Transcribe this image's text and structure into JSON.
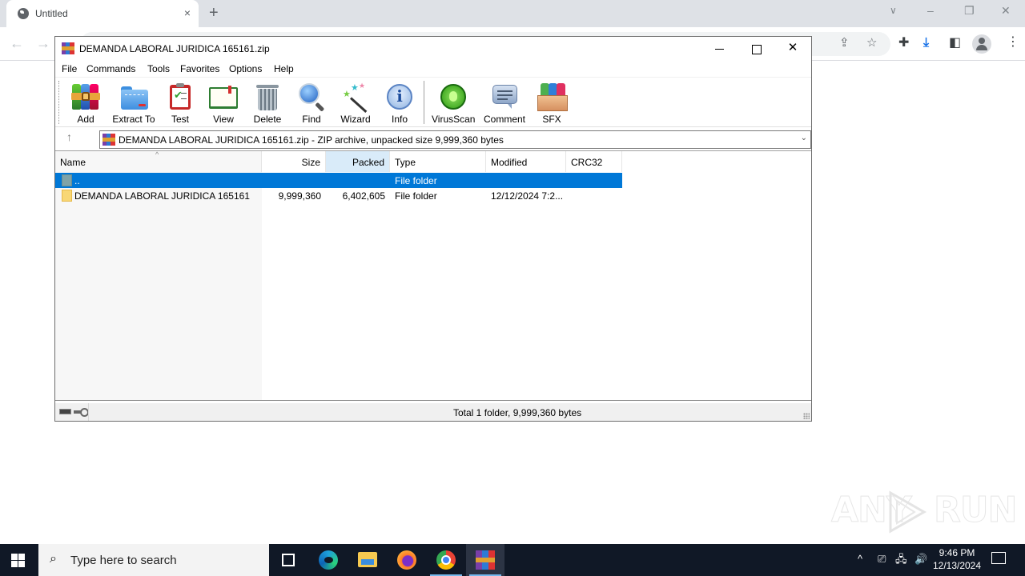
{
  "browser": {
    "tab_title": "Untitled",
    "tab_close": "×",
    "new_tab": "+",
    "tab_search_icon": "chevron-down",
    "window_controls": {
      "minimize": "–",
      "restore": "❐",
      "close": "✕"
    },
    "nav": {
      "back": "←",
      "forward": "→"
    },
    "toolbar_icons": [
      "share-icon",
      "star-icon",
      "extensions-icon",
      "download-icon",
      "side-panel-icon",
      "profile-icon",
      "menu-icon"
    ],
    "toolbar_glyphs": {
      "share": "⇪",
      "star": "☆",
      "extensions": "✚",
      "download": "⤓",
      "side_panel": "◧",
      "menu": "⋮"
    }
  },
  "winrar": {
    "title": "DEMANDA LABORAL JURIDICA 165161.zip",
    "window_controls": {
      "close": "✕"
    },
    "menu": [
      "File",
      "Commands",
      "Tools",
      "Favorites",
      "Options",
      "Help"
    ],
    "toolbar": [
      {
        "id": "add",
        "label": "Add"
      },
      {
        "id": "extract",
        "label": "Extract To"
      },
      {
        "id": "test",
        "label": "Test"
      },
      {
        "id": "view",
        "label": "View"
      },
      {
        "id": "delete",
        "label": "Delete"
      },
      {
        "id": "find",
        "label": "Find"
      },
      {
        "id": "wizard",
        "label": "Wizard"
      },
      {
        "id": "info",
        "label": "Info"
      },
      {
        "id": "virusscan",
        "label": "VirusScan"
      },
      {
        "id": "comment",
        "label": "Comment"
      },
      {
        "id": "sfx",
        "label": "SFX"
      }
    ],
    "address": {
      "up_glyph": "↑",
      "path": "DEMANDA LABORAL JURIDICA 165161.zip - ZIP archive, unpacked size 9,999,360 bytes",
      "dropdown_glyph": "⌄"
    },
    "columns": [
      "Name",
      "Size",
      "Packed",
      "Type",
      "Modified",
      "CRC32"
    ],
    "sort_column": "Packed",
    "sort_glyph": "^",
    "rows": [
      {
        "name": "..",
        "size": "",
        "packed": "",
        "type": "File folder",
        "modified": "",
        "crc32": "",
        "selected": true,
        "icon": "parent-folder-icon"
      },
      {
        "name": "DEMANDA LABORAL JURIDICA 165161",
        "size": "9,999,360",
        "packed": "6,402,605",
        "type": "File folder",
        "modified": "12/12/2024 7:2...",
        "crc32": "",
        "selected": false,
        "icon": "folder-icon"
      }
    ],
    "status": "Total 1 folder, 9,999,360 bytes"
  },
  "watermark": {
    "left": "ANY",
    "right": "RUN"
  },
  "taskbar": {
    "search_placeholder": "Type here to search",
    "search_glyph": "⚲",
    "apps": [
      "task-view",
      "edge",
      "file-explorer",
      "firefox",
      "chrome",
      "winrar"
    ],
    "active_app": "winrar",
    "tray": {
      "chevron": "^",
      "meet": "⎚",
      "network": "🖧",
      "volume": "🔊"
    },
    "time": "9:46 PM",
    "date": "12/13/2024"
  },
  "colors": {
    "selection": "#0078d7",
    "sorted_header": "#d9ebf9",
    "taskbar": "#101826",
    "chrome_tabbar": "#dee1e6",
    "download_accent": "#1a73e8"
  }
}
